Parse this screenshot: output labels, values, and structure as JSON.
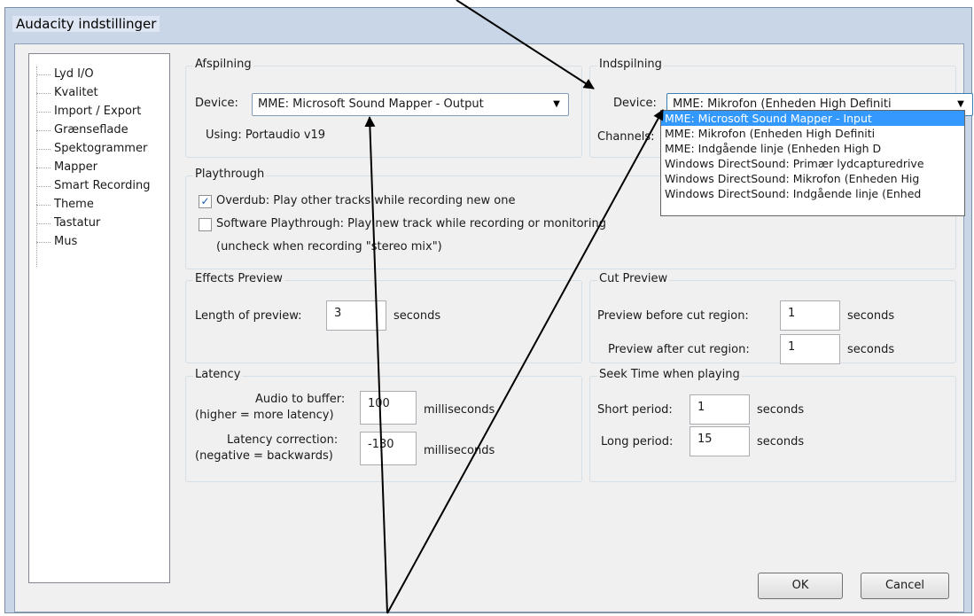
{
  "window": {
    "title": "Audacity indstillinger"
  },
  "tree": {
    "items": [
      "Lyd I/O",
      "Kvalitet",
      "Import / Export",
      "Grænseflade",
      "Spektogrammer",
      "Mapper",
      "Smart Recording",
      "Theme",
      "Tastatur",
      "Mus"
    ]
  },
  "playback": {
    "group": "Afspilning",
    "device_label": "Device:",
    "device_value": "MME: Microsoft Sound Mapper - Output",
    "using_text": "Using: Portaudio v19"
  },
  "recording": {
    "group": "Indspilning",
    "device_label": "Device:",
    "device_value": "MME: Mikrofon (Enheden High Definiti",
    "channels_label": "Channels:",
    "options": [
      "MME: Microsoft Sound Mapper - Input",
      "MME: Mikrofon (Enheden High Definiti",
      "MME: Indgående linje (Enheden High D",
      "Windows DirectSound: Primær lydcapturedrive",
      "Windows DirectSound: Mikrofon (Enheden Hig",
      "Windows DirectSound: Indgående linje (Enhed"
    ],
    "selected_option": "MME: Microsoft Sound Mapper - Input"
  },
  "playthrough": {
    "group": "Playthrough",
    "overdub_label": "Overdub: Play other tracks while recording new one",
    "overdub_checked": true,
    "software_label": "Software Playthrough: Play new track while recording or monitoring",
    "software_checked": false,
    "note": "(uncheck when recording \"stereo mix\")"
  },
  "effects_preview": {
    "group": "Effects Preview",
    "length_label": "Length of preview:",
    "length_value": "3",
    "unit": "seconds"
  },
  "cut_preview": {
    "group": "Cut Preview",
    "before_label": "Preview before cut region:",
    "before_value": "1",
    "before_unit": "seconds",
    "after_label": "Preview after cut region:",
    "after_value": "1",
    "after_unit": "seconds"
  },
  "latency": {
    "group": "Latency",
    "buffer_label_1": "Audio to buffer:",
    "buffer_label_2": "(higher = more latency)",
    "buffer_value": "100",
    "buffer_unit": "milliseconds",
    "correction_label_1": "Latency correction:",
    "correction_label_2": "(negative = backwards)",
    "correction_value": "-130",
    "correction_unit": "milliseconds"
  },
  "seek": {
    "group": "Seek Time when playing",
    "short_label": "Short period:",
    "short_value": "1",
    "short_unit": "seconds",
    "long_label": "Long period:",
    "long_value": "15",
    "long_unit": "seconds"
  },
  "buttons": {
    "ok": "OK",
    "cancel": "Cancel"
  },
  "icons": {
    "tick": "✓",
    "dropdown": "▼"
  },
  "colors": {
    "selection": "#3399ff",
    "title_bar": "#c9d6e8"
  }
}
